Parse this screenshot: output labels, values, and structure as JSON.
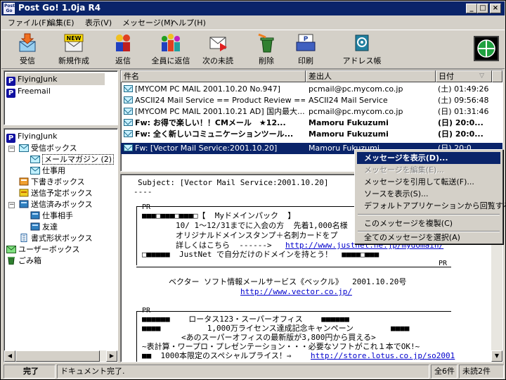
{
  "window": {
    "title": "Post Go! 1.0ja R4",
    "app_icon_text": "Post Go"
  },
  "menu": [
    "ファイル(F)",
    "編集(E)",
    "表示(V)",
    "メッセージ(M)",
    "ヘルプ(H)"
  ],
  "toolbar": [
    {
      "label": "受信",
      "icon": "receive-icon"
    },
    {
      "label": "新規作成",
      "icon": "new-mail-icon"
    },
    {
      "label": "返信",
      "icon": "reply-icon"
    },
    {
      "label": "全員に返信",
      "icon": "reply-all-icon"
    },
    {
      "label": "次の未読",
      "icon": "next-unread-icon"
    },
    {
      "label": "削除",
      "icon": "delete-icon"
    },
    {
      "label": "印刷",
      "icon": "print-icon"
    },
    {
      "label": "アドレス帳",
      "icon": "address-book-icon"
    }
  ],
  "new_icon_text": "NEW",
  "print_icon_text": "P",
  "accounts": [
    "FlyingJunk",
    "Freemail"
  ],
  "tree": {
    "root": "FlyingJunk",
    "inbox": "受信ボックス",
    "magazine": "メールマガジン (2)",
    "work": "仕事用",
    "drafts": "下書きボックス",
    "outbox": "送信予定ボックス",
    "sent": "送信済みボックス",
    "sent_work": "仕事相手",
    "sent_friends": "友達",
    "templates": "書式形状ボックス",
    "user_box": "ユーザーボックス",
    "trash": "ごみ箱"
  },
  "list": {
    "columns": {
      "subject": "件名",
      "from": "差出人",
      "date": "日付"
    },
    "rows": [
      {
        "subject": "[MYCOM PC MAIL 2001.10.20 No.947]",
        "from": "pcmail@pc.mycom.co.jp",
        "date": "(土) 01:49:26",
        "bold": false
      },
      {
        "subject": "ASCII24 Mail Service == Product Review == ...",
        "from": "ASCII24 Mail Service",
        "date": "(土) 09:56:48",
        "bold": false
      },
      {
        "subject": "[MYCOM PC MAIL 2001.10.21 AD] 国内最大...",
        "from": "pcmail@pc.mycom.co.jp",
        "date": "(日) 01:31:46",
        "bold": false
      },
      {
        "subject": "Fw: お得で楽しい！！CMメール　★12...",
        "from": "Mamoru Fukuzumi",
        "date": "(日) 20:0...",
        "bold": true
      },
      {
        "subject": "Fw: 全く新しいコミュニケーションツール...",
        "from": "Mamoru Fukuzumi",
        "date": "(日) 20:0...",
        "bold": true
      },
      {
        "subject": "Fw: [Vector Mail Service:2001.10.20]",
        "from": "Mamoru Fukuzumi",
        "date": "(日) 20:0...",
        "bold": false
      }
    ]
  },
  "preview": {
    "subject_line": "Subject: [Vector Mail Service:2001.10.20]",
    "dashes": "----",
    "pr": "PR",
    "ad1_line1": "■■■□■■■□■■■□【  Myドメインパック  】",
    "ad1_line2": "10/ 1～12/31までに入会の方  先着1,000名様",
    "ad1_line3": "オリジナルドメインスタンプ＋名刺カードをプ",
    "ad1_line4": "詳しくはこちら  ------>",
    "ad1_link": "http://www.justnet.ne.jp/mydomain/",
    "ad1_line5": "□■■■■■  JustNet で自分だけのドメインを持とう！  ■■■■□■■■",
    "vector_line": "ベクター ソフト情報メールサービス《ベックル》  2001.10.20号",
    "vector_link": "http://www.vector.co.jp/",
    "ad2_line1": "■■■■■■    ロータス123・スーパーオフィス    ■■■■■■",
    "ad2_line2": "■■■■          1,000万ライセンス達成記念キャンペーン        ■■■■",
    "ad2_line3": "<あのスーパーオフィスの最新版が3,800円から買える>",
    "ad2_line4": "~表計算・ワープロ・プレゼンテーション・・・必要なソフトがこれ１本でOK!~",
    "ad2_line5": "■■  1000本限定のスペシャルプライス！⇒",
    "ad2_link": "http://store.lotus.co.jp/so2001"
  },
  "context_menu": {
    "items": [
      {
        "label": "メッセージを表示(D)...",
        "state": "active"
      },
      {
        "label": "メッセージを編集(E)...",
        "state": "disabled"
      },
      {
        "label": "メッセージを引用して転送(F)...",
        "state": "normal"
      },
      {
        "label": "ソースを表示(S)...",
        "state": "normal"
      },
      {
        "label": "デフォルトアプリケーションから回覧する(O)...",
        "state": "normal"
      },
      {
        "label": "このメッセージを複製(C)",
        "state": "normal"
      },
      {
        "label": "全てのメッセージを選択(A)",
        "state": "normal"
      }
    ]
  },
  "status": {
    "main": "完了",
    "message": "ドキュメント完了.",
    "total": "全6件",
    "unread": "未読2件"
  }
}
